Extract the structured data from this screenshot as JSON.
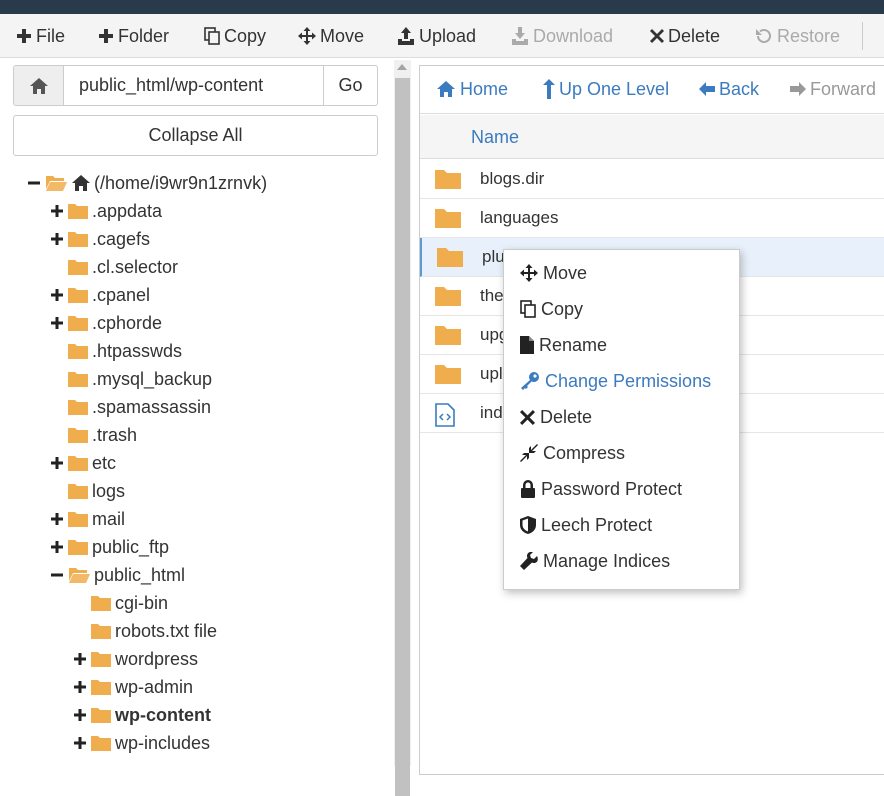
{
  "toolbar": {
    "items": [
      {
        "label": "File",
        "icon": "plus-icon",
        "disabled": false
      },
      {
        "label": "Folder",
        "icon": "plus-icon",
        "disabled": false
      },
      {
        "label": "Copy",
        "icon": "copy-icon",
        "disabled": false
      },
      {
        "label": "Move",
        "icon": "move-icon",
        "disabled": false
      },
      {
        "label": "Upload",
        "icon": "upload-icon",
        "disabled": false
      },
      {
        "label": "Download",
        "icon": "download-icon",
        "disabled": true
      },
      {
        "label": "Delete",
        "icon": "close-icon",
        "disabled": false
      },
      {
        "label": "Restore",
        "icon": "undo-icon",
        "disabled": true
      }
    ]
  },
  "left": {
    "path_value": "public_html/wp-content",
    "go_label": "Go",
    "collapse_label": "Collapse All",
    "tree": [
      {
        "label": "(/home/i9wr9n1zrnvk)",
        "toggle": "minus",
        "icon": "home"
      },
      {
        "label": ".appdata",
        "toggle": "plus"
      },
      {
        "label": ".cagefs",
        "toggle": "plus"
      },
      {
        "label": ".cl.selector",
        "toggle": "none"
      },
      {
        "label": ".cpanel",
        "toggle": "plus"
      },
      {
        "label": ".cphorde",
        "toggle": "plus"
      },
      {
        "label": ".htpasswds",
        "toggle": "none"
      },
      {
        "label": ".mysql_backup",
        "toggle": "none"
      },
      {
        "label": ".spamassassin",
        "toggle": "none"
      },
      {
        "label": ".trash",
        "toggle": "none"
      },
      {
        "label": "etc",
        "toggle": "plus"
      },
      {
        "label": "logs",
        "toggle": "none"
      },
      {
        "label": "mail",
        "toggle": "plus"
      },
      {
        "label": "public_ftp",
        "toggle": "plus"
      },
      {
        "label": "public_html",
        "toggle": "minus",
        "open": true
      },
      {
        "label": "cgi-bin",
        "toggle": "none",
        "level": 2
      },
      {
        "label": "robots.txt file",
        "toggle": "none",
        "level": 2
      },
      {
        "label": "wordpress",
        "toggle": "plus",
        "level": 2
      },
      {
        "label": "wp-admin",
        "toggle": "plus",
        "level": 2
      },
      {
        "label": "wp-content",
        "toggle": "plus",
        "level": 2,
        "bold": true
      },
      {
        "label": "wp-includes",
        "toggle": "plus",
        "level": 2
      }
    ]
  },
  "right": {
    "nav": [
      {
        "label": "Home",
        "icon": "home-icon",
        "disabled": false
      },
      {
        "label": "Up One Level",
        "icon": "level-up-icon",
        "disabled": false
      },
      {
        "label": "Back",
        "icon": "arrow-left-icon",
        "disabled": false
      },
      {
        "label": "Forward",
        "icon": "arrow-right-icon",
        "disabled": true
      }
    ],
    "column_name": "Name",
    "files": [
      {
        "name": "blogs.dir",
        "type": "folder"
      },
      {
        "name": "languages",
        "type": "folder"
      },
      {
        "name": "plu",
        "type": "folder",
        "selected": true
      },
      {
        "name": "the",
        "type": "folder"
      },
      {
        "name": "upg",
        "type": "folder"
      },
      {
        "name": "upl",
        "type": "folder"
      },
      {
        "name": "ind",
        "type": "code-file"
      }
    ]
  },
  "context_menu": {
    "items": [
      {
        "label": "Move",
        "icon": "move-icon"
      },
      {
        "label": "Copy",
        "icon": "copy-icon"
      },
      {
        "label": "Rename",
        "icon": "file-icon"
      },
      {
        "label": "Change Permissions",
        "icon": "key-icon",
        "active": true
      },
      {
        "label": "Delete",
        "icon": "close-icon"
      },
      {
        "label": "Compress",
        "icon": "compress-icon"
      },
      {
        "label": "Password Protect",
        "icon": "lock-icon"
      },
      {
        "label": "Leech Protect",
        "icon": "shield-icon"
      },
      {
        "label": "Manage Indices",
        "icon": "wrench-icon"
      }
    ]
  },
  "colors": {
    "link": "#3b7bbf",
    "folder": "#f0ad4e",
    "topbar": "#293a4a"
  }
}
